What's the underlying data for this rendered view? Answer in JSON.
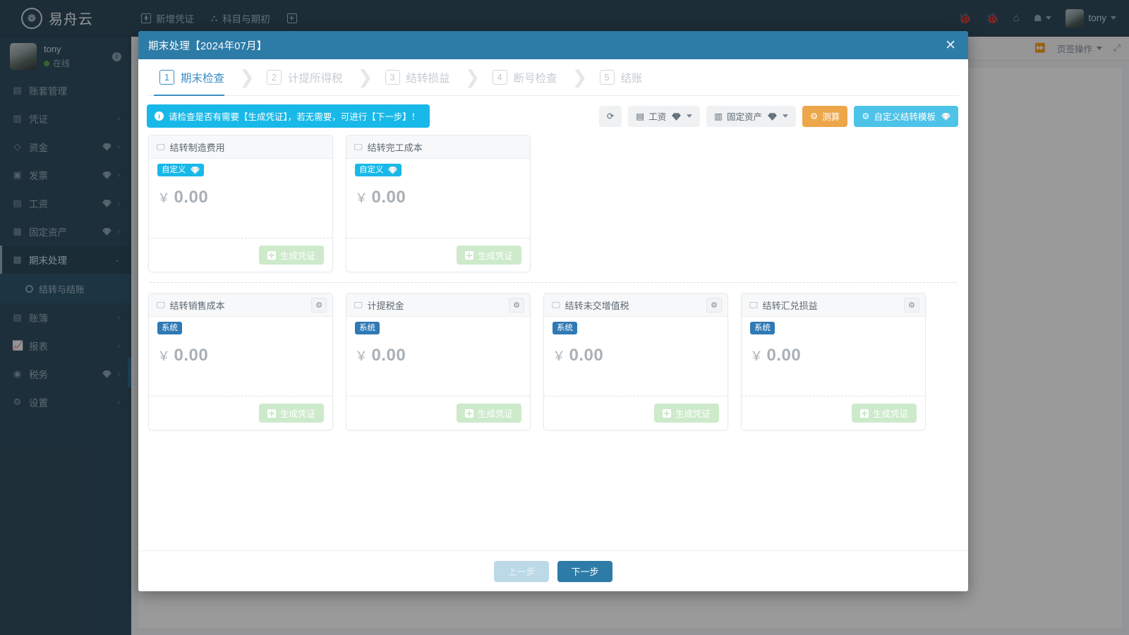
{
  "topbar": {
    "brand": "易舟云",
    "nav": [
      {
        "label": "新增凭证",
        "icon": "plus-square-icon"
      },
      {
        "label": "科目与期初",
        "icon": "sitemap-icon"
      },
      {
        "label": "",
        "icon": "grid-icon"
      }
    ],
    "right": {
      "icons": [
        "bug-icon",
        "bug-icon",
        "home-icon",
        "user-dropdown-icon"
      ],
      "username": "tony"
    }
  },
  "sidebar": {
    "user": {
      "name": "tony",
      "status": "在线",
      "info": "i"
    },
    "items": [
      {
        "label": "账套管理",
        "icon": "book-icon",
        "gem": false,
        "arrow": "",
        "active": false
      },
      {
        "label": "凭证",
        "icon": "voucher-icon",
        "gem": false,
        "arrow": "›",
        "active": false
      },
      {
        "label": "资金",
        "icon": "fund-icon",
        "gem": true,
        "arrow": "›",
        "active": false
      },
      {
        "label": "发票",
        "icon": "invoice-icon",
        "gem": true,
        "arrow": "›",
        "active": false
      },
      {
        "label": "工资",
        "icon": "salary-icon",
        "gem": true,
        "arrow": "›",
        "active": false
      },
      {
        "label": "固定资产",
        "icon": "asset-icon",
        "gem": true,
        "arrow": "›",
        "active": false
      },
      {
        "label": "期末处理",
        "icon": "calendar-icon",
        "gem": false,
        "arrow": "⌄",
        "active": true
      },
      {
        "label": "账簿",
        "icon": "ledger-icon",
        "gem": false,
        "arrow": "›",
        "active": false
      },
      {
        "label": "报表",
        "icon": "chart-icon",
        "gem": false,
        "arrow": "›",
        "active": false
      },
      {
        "label": "税务",
        "icon": "tax-icon",
        "gem": true,
        "arrow": "›",
        "active": false
      },
      {
        "label": "设置",
        "icon": "gear-icon",
        "gem": false,
        "arrow": "›",
        "active": false
      }
    ],
    "sub_item": {
      "label": "结转与结账",
      "icon": "circle-dot-icon"
    },
    "collapse": "‹"
  },
  "background": {
    "tab_ops_label": "页签操作",
    "forward_icon": "fast-forward-icon",
    "expand_icon": "expand-icon"
  },
  "modal": {
    "title": "期末处理【2024年07月】",
    "close": "✕",
    "steps": [
      {
        "num": "1",
        "label": "期末检查",
        "active": true
      },
      {
        "num": "2",
        "label": "计提所得税",
        "active": false
      },
      {
        "num": "3",
        "label": "结转损益",
        "active": false
      },
      {
        "num": "4",
        "label": "断号检查",
        "active": false
      },
      {
        "num": "5",
        "label": "结账",
        "active": false
      }
    ],
    "alert": "请检查是否有需要【生成凭证】，若无需要，可进行【下一步】！",
    "toolbar": [
      {
        "name": "refresh-button",
        "label": "",
        "style": "plain",
        "gem": false,
        "caret": false,
        "icon": "refresh-icon"
      },
      {
        "name": "salary-dropdown-button",
        "label": "工资",
        "style": "plain",
        "gem": true,
        "caret": true,
        "icon": "card-icon"
      },
      {
        "name": "asset-dropdown-button",
        "label": "固定资产",
        "style": "plain",
        "gem": true,
        "caret": true,
        "icon": "building-icon"
      },
      {
        "name": "calculate-button",
        "label": "测算",
        "style": "orange",
        "gem": false,
        "caret": false,
        "icon": "sliders-icon"
      },
      {
        "name": "custom-template-button",
        "label": "自定义结转模板",
        "style": "cyan",
        "gem": true,
        "caret": false,
        "icon": "gear-icon"
      }
    ],
    "cards_row1": [
      {
        "title": "结转制造费用",
        "tag": "自定义",
        "tag_type": "custom",
        "gem": true,
        "amount": "0.00",
        "currency": "￥",
        "gear": false,
        "action": "生成凭证"
      },
      {
        "title": "结转完工成本",
        "tag": "自定义",
        "tag_type": "custom",
        "gem": true,
        "amount": "0.00",
        "currency": "￥",
        "gear": false,
        "action": "生成凭证"
      }
    ],
    "cards_row2": [
      {
        "title": "结转销售成本",
        "tag": "系统",
        "tag_type": "system",
        "gem": false,
        "amount": "0.00",
        "currency": "￥",
        "gear": true,
        "action": "生成凭证"
      },
      {
        "title": "计提税金",
        "tag": "系统",
        "tag_type": "system",
        "gem": false,
        "amount": "0.00",
        "currency": "￥",
        "gear": true,
        "action": "生成凭证"
      },
      {
        "title": "结转未交增值税",
        "tag": "系统",
        "tag_type": "system",
        "gem": false,
        "amount": "0.00",
        "currency": "￥",
        "gear": true,
        "action": "生成凭证"
      },
      {
        "title": "结转汇兑损益",
        "tag": "系统",
        "tag_type": "system",
        "gem": false,
        "amount": "0.00",
        "currency": "￥",
        "gear": true,
        "action": "生成凭证"
      }
    ],
    "footer": {
      "prev": "上一步",
      "next": "下一步"
    }
  },
  "colors": {
    "sidebar_bg": "#1d3c50",
    "modal_header": "#2d7ba7",
    "accent_cyan": "#18b9e8",
    "accent_orange": "#eda64a",
    "tag_system": "#2f79b5",
    "step_active": "#3b8ec4",
    "online_green": "#4e9a3e"
  }
}
